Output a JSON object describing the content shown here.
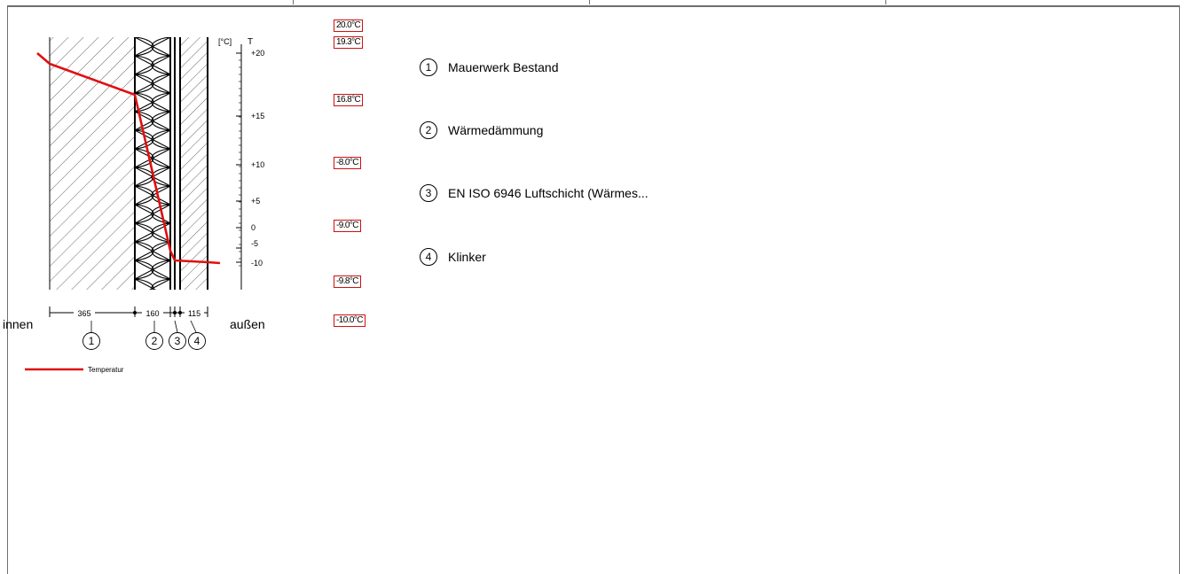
{
  "side_labels": {
    "inside": "innen",
    "outside": "außen"
  },
  "axis": {
    "unit": "[°C]",
    "symbol": "T",
    "ticks": [
      {
        "value": 20,
        "label": "+20"
      },
      {
        "value": 15,
        "label": "+15"
      },
      {
        "value": 10,
        "label": "+10"
      },
      {
        "value": 5,
        "label": "+5"
      },
      {
        "value": 0,
        "label": "0"
      },
      {
        "value": -5,
        "label": "-5"
      },
      {
        "value": -10,
        "label": "-10"
      }
    ]
  },
  "layers": [
    {
      "number": "1",
      "name": "Mauerwerk Bestand",
      "thickness": "365"
    },
    {
      "number": "2",
      "name": "Wärmedämmung",
      "thickness": "160"
    },
    {
      "number": "3",
      "name": "EN ISO 6946 Luftschicht (Wärmes...",
      "thickness": ""
    },
    {
      "number": "4",
      "name": "Klinker",
      "thickness": "115"
    }
  ],
  "temperature_labels": [
    "20.0°C",
    "19.3°C",
    "16.8°C",
    "-8.0°C",
    "-9.0°C",
    "-9.8°C",
    "-10.0°C"
  ],
  "legend": {
    "label": "Temperatur",
    "color": "#e01010"
  },
  "chart_data": {
    "type": "line",
    "series": [
      {
        "name": "Temperatur",
        "x_boundaries_mm": [
          0,
          365,
          525,
          565,
          680
        ],
        "values": [
          19.3,
          16.8,
          -8.0,
          -9.0,
          -9.8
        ]
      }
    ],
    "surface_temperatures": {
      "inside_air": 20.0,
      "outside_air": -10.0
    },
    "ylabel": "T [°C]",
    "ylim": [
      -10,
      20
    ]
  }
}
